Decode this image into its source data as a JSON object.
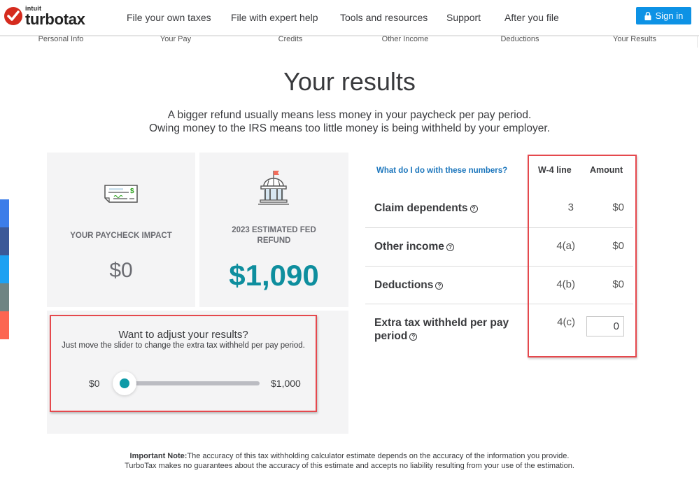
{
  "header": {
    "logo_brand": "intuit",
    "logo_product": "turbotax",
    "nav": [
      {
        "label": "File your own taxes"
      },
      {
        "label": "File with expert help"
      },
      {
        "label": "Tools and resources"
      },
      {
        "label": "Support"
      },
      {
        "label": "After you file"
      }
    ],
    "sign_in_label": "Sign in",
    "sign_in_icon": "lock-icon"
  },
  "steps": [
    {
      "label": "Personal Info"
    },
    {
      "label": "Your Pay"
    },
    {
      "label": "Credits"
    },
    {
      "label": "Other Income"
    },
    {
      "label": "Deductions"
    },
    {
      "label": "Your Results"
    }
  ],
  "page": {
    "title": "Your results",
    "subtitle_line1": "A bigger refund usually means less money in your paycheck per pay period.",
    "subtitle_line2": "Owing money to the IRS means too little money is being withheld by your employer."
  },
  "cards": {
    "paycheck": {
      "icon": "paycheck-icon",
      "label": "YOUR PAYCHECK IMPACT",
      "value": "$0"
    },
    "refund": {
      "icon": "government-building-icon",
      "label_line1": "2023 ESTIMATED FED",
      "label_line2": "REFUND",
      "value": "$1,090"
    }
  },
  "slider": {
    "title": "Want to adjust your results?",
    "description": "Just move the slider to change the extra tax withheld per pay period.",
    "min_label": "$0",
    "max_label": "$1,000",
    "min": 0,
    "max": 1000,
    "value": 0
  },
  "table": {
    "help_link": "What do I do with these numbers?",
    "col_line": "W-4 line",
    "col_amount": "Amount",
    "rows": [
      {
        "label": "Claim dependents",
        "line": "3",
        "amount": "$0"
      },
      {
        "label": "Other income",
        "line": "4(a)",
        "amount": "$0"
      },
      {
        "label": "Deductions",
        "line": "4(b)",
        "amount": "$0"
      },
      {
        "label_line1": "Extra tax withheld per pay",
        "label_line2": "period",
        "line": "4(c)",
        "amount_input_value": "0"
      }
    ]
  },
  "note": {
    "bold": "Important Note:",
    "line1": "The accuracy of this tax withholding calculator estimate depends on the accuracy of the information you provide.",
    "line2": "TurboTax makes no guarantees about the accuracy of this estimate and accepts no liability resulting from your use of the estimation."
  },
  "share_buttons": [
    {
      "icon": "twitter-icon",
      "color": "#3b7de9"
    },
    {
      "icon": "facebook-icon",
      "color": "#3b5998"
    },
    {
      "icon": "twitter-icon",
      "color": "#1da1f2"
    },
    {
      "icon": "linkedin-icon",
      "color": "#6f8483"
    },
    {
      "icon": "email-icon",
      "color": "#fc6651"
    }
  ],
  "colors": {
    "accent": "#0d92e5",
    "refund": "#0e8e9e",
    "highlight": "#e5484d"
  }
}
